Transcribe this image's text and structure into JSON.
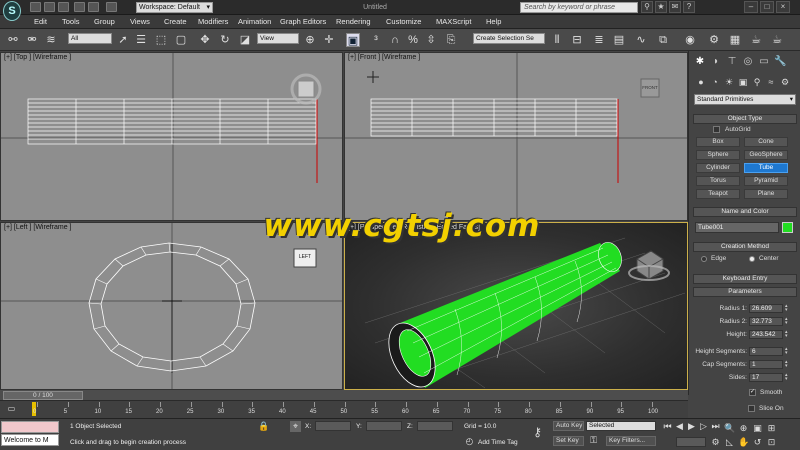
{
  "app": {
    "logo_glyph": "S",
    "workspace": "Workspace: Default",
    "doc_title": "Untitled",
    "search_placeholder": "Search by keyword or phrase"
  },
  "menu": [
    "Edit",
    "Tools",
    "Group",
    "Views",
    "Create",
    "Modifiers",
    "Animation",
    "Graph Editors",
    "Rendering",
    "Customize",
    "MAXScript",
    "Help"
  ],
  "toolbar": {
    "selection_filter": "All",
    "ref_coord": "View",
    "named_sel": "Create Selection Se"
  },
  "viewports": {
    "top": {
      "label": "[+] [Top ] [Wireframe ]"
    },
    "front": {
      "label": "[+] [Front ] [Wireframe ]",
      "viewcube": "FRONT"
    },
    "left": {
      "label": "[+] [Left ] [Wireframe ]",
      "viewcube": "LEFT"
    },
    "persp": {
      "label": "[+] [Perspective] [Realistic + Edged Faces]"
    }
  },
  "watermark": "www.cgtsj.com",
  "command_panel": {
    "primitive_type": "Standard Primitives",
    "object_type": {
      "title": "Object Type",
      "autogrid": "AutoGrid",
      "buttons": [
        "Box",
        "Cone",
        "Sphere",
        "GeoSphere",
        "Cylinder",
        "Tube",
        "Torus",
        "Pyramid",
        "Teapot",
        "Plane"
      ],
      "active": "Tube"
    },
    "name_color": {
      "title": "Name and Color",
      "name": "Tube001",
      "color": "#22dd22"
    },
    "creation_method": {
      "title": "Creation Method",
      "options": [
        "Edge",
        "Center"
      ],
      "selected": "Center"
    },
    "keyboard_entry": {
      "title": "Keyboard Entry"
    },
    "parameters": {
      "title": "Parameters",
      "radius1": {
        "label": "Radius 1:",
        "value": "26.609"
      },
      "radius2": {
        "label": "Radius 2:",
        "value": "32.773"
      },
      "height": {
        "label": "Height:",
        "value": "243.542"
      },
      "height_segments": {
        "label": "Height Segments:",
        "value": "6"
      },
      "cap_segments": {
        "label": "Cap Segments:",
        "value": "1"
      },
      "sides": {
        "label": "Sides:",
        "value": "17"
      },
      "smooth": {
        "label": "Smooth",
        "checked": true
      },
      "slice_on": {
        "label": "Slice On",
        "checked": false
      }
    }
  },
  "timeline": {
    "frame_readout": "0 / 100",
    "ticks": [
      "0",
      "5",
      "10",
      "15",
      "20",
      "25",
      "30",
      "35",
      "40",
      "45",
      "50",
      "55",
      "60",
      "65",
      "70",
      "75",
      "80",
      "85",
      "90",
      "95",
      "100"
    ]
  },
  "status": {
    "maxscript": "Welcome to M",
    "selected": "1 Object Selected",
    "prompt": "Click and drag to begin creation process",
    "x_label": "X:",
    "y_label": "Y:",
    "z_label": "Z:",
    "grid": "Grid = 10.0",
    "add_time_tag": "Add Time Tag",
    "auto_key": "Auto Key",
    "set_key": "Set Key",
    "key_mode": "Selected",
    "key_filters": "Key Filters..."
  },
  "colors": {
    "tube_green": "#22dd22",
    "active_button": "#1e78d0",
    "watermark": "#f2d000",
    "persp_border": "#ccb04a"
  }
}
